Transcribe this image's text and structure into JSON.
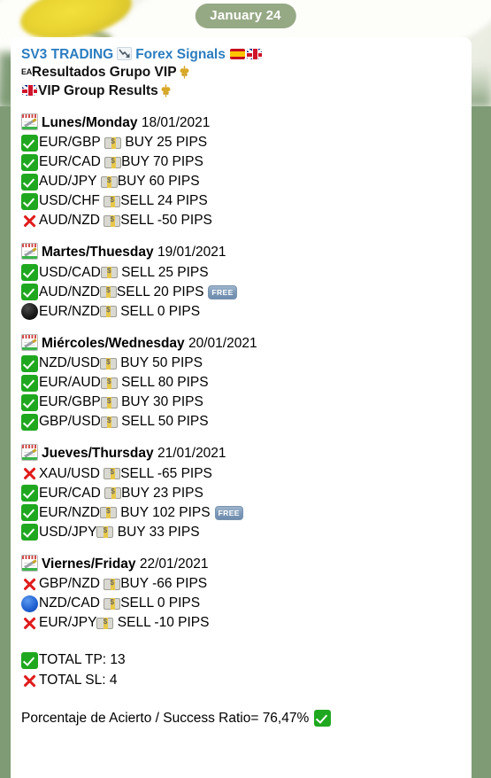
{
  "date_pill": {
    "label": "January 24"
  },
  "header": {
    "channel_name": "SV3 TRADING",
    "chart_icon": "chart-decreasing-icon",
    "channel_suffix": "Forex Signals",
    "flag_es": "flag-spain-icon",
    "flag_gb": "flag-uk-icon",
    "line2_flag": "EA",
    "line2_text": "Resultados Grupo VIP",
    "line2_fleur": "fleur-de-lis-icon",
    "line3_flag": "flag-uk-icon",
    "line3_text": "VIP Group Results",
    "line3_fleur": "fleur-de-lis-icon"
  },
  "days": [
    {
      "calendar_icon": "calendar-icon",
      "name": "Lunes/Monday",
      "date": "18/01/2021",
      "signals": [
        {
          "status": "check",
          "pair": "EUR/GBP",
          "money": "banknote-icon",
          "action": "BUY 25 PIPS",
          "gap_before_money": true,
          "gap_after_money": true,
          "free": false
        },
        {
          "status": "check",
          "pair": "EUR/CAD",
          "money": "banknote-icon",
          "action": "BUY 70 PIPS",
          "gap_before_money": true,
          "gap_after_money": false,
          "free": false
        },
        {
          "status": "check",
          "pair": "AUD/JPY",
          "money": "banknote-icon",
          "action": "BUY 60 PIPS",
          "gap_before_money": true,
          "gap_after_money": false,
          "free": false
        },
        {
          "status": "check",
          "pair": "USD/CHF",
          "money": "banknote-icon",
          "action": "SELL 24 PIPS",
          "gap_before_money": true,
          "gap_after_money": false,
          "free": false
        },
        {
          "status": "cross",
          "pair": "AUD/NZD",
          "money": "banknote-icon",
          "action": "SELL -50 PIPS",
          "gap_before_money": true,
          "gap_after_money": false,
          "free": false
        }
      ]
    },
    {
      "calendar_icon": "calendar-icon",
      "name": "Martes/Thuesday",
      "date": "19/01/2021",
      "signals": [
        {
          "status": "check",
          "pair": "USD/CAD",
          "money": "banknote-icon",
          "action": "SELL 25 PIPS",
          "gap_before_money": false,
          "gap_after_money": true,
          "free": false
        },
        {
          "status": "check",
          "pair": "AUD/NZD",
          "money": "banknote-icon",
          "action": "SELL 20 PIPS",
          "gap_before_money": false,
          "gap_after_money": false,
          "free": true
        },
        {
          "status": "circle-black",
          "pair": "EUR/NZD",
          "money": "banknote-icon",
          "action": "SELL 0 PIPS",
          "gap_before_money": false,
          "gap_after_money": true,
          "free": false
        }
      ]
    },
    {
      "calendar_icon": "calendar-icon",
      "name": "Miércoles/Wednesday",
      "date": "20/01/2021",
      "signals": [
        {
          "status": "check",
          "pair": "NZD/USD",
          "money": "banknote-icon",
          "action": "BUY 50 PIPS",
          "gap_before_money": false,
          "gap_after_money": true,
          "free": false
        },
        {
          "status": "check",
          "pair": "EUR/AUD",
          "money": "banknote-icon",
          "action": "SELL 80 PIPS",
          "gap_before_money": false,
          "gap_after_money": true,
          "free": false
        },
        {
          "status": "check",
          "pair": "EUR/GBP",
          "money": "banknote-icon",
          "action": "BUY 30 PIPS",
          "gap_before_money": false,
          "gap_after_money": true,
          "free": false
        },
        {
          "status": "check",
          "pair": "GBP/USD",
          "money": "banknote-icon",
          "action": "SELL 50 PIPS",
          "gap_before_money": false,
          "gap_after_money": true,
          "free": false
        }
      ]
    },
    {
      "calendar_icon": "calendar-icon",
      "name": "Jueves/Thursday",
      "date": "21/01/2021",
      "signals": [
        {
          "status": "cross",
          "pair": "XAU/USD",
          "money": "banknote-icon",
          "action": "SELL -65 PIPS",
          "gap_before_money": true,
          "gap_after_money": false,
          "free": false
        },
        {
          "status": "check",
          "pair": "EUR/CAD",
          "money": "banknote-icon",
          "action": "BUY 23 PIPS",
          "gap_before_money": true,
          "gap_after_money": false,
          "free": false
        },
        {
          "status": "check",
          "pair": "EUR/NZD",
          "money": "banknote-icon",
          "action": "BUY 102 PIPS",
          "gap_before_money": false,
          "gap_after_money": true,
          "free": true
        },
        {
          "status": "check",
          "pair": "USD/JPY",
          "money": "banknote-icon",
          "action": "BUY 33 PIPS",
          "gap_before_money": false,
          "gap_after_money": true,
          "free": false
        }
      ]
    },
    {
      "calendar_icon": "calendar-icon",
      "name": "Viernes/Friday",
      "date": "22/01/2021",
      "signals": [
        {
          "status": "cross",
          "pair": "GBP/NZD",
          "money": "banknote-icon",
          "action": "BUY -66 PIPS",
          "gap_before_money": true,
          "gap_after_money": false,
          "free": false
        },
        {
          "status": "circle-blue",
          "pair": "NZD/CAD",
          "money": "banknote-icon",
          "action": "SELL 0 PIPS",
          "gap_before_money": true,
          "gap_after_money": false,
          "free": false
        },
        {
          "status": "cross",
          "pair": "EUR/JPY",
          "money": "banknote-icon",
          "action": "SELL -10 PIPS",
          "gap_before_money": false,
          "gap_after_money": true,
          "free": false
        }
      ]
    }
  ],
  "totals": [
    {
      "status": "check",
      "label": "TOTAL TP: 13"
    },
    {
      "status": "cross",
      "label": "TOTAL SL: 4"
    }
  ],
  "ratio": {
    "text": "Porcentaje de Acierto / Success Ratio= 76,47%",
    "status": "check"
  },
  "colors": {
    "page_background": "#7e9b75",
    "card_background": "#ffffff",
    "title_blue": "#2b7dc0",
    "check_green": "#1fa81f",
    "cross_red": "#e01b1b",
    "free_badge_blue": "#7e9ab9",
    "pill_green": "#789164"
  }
}
